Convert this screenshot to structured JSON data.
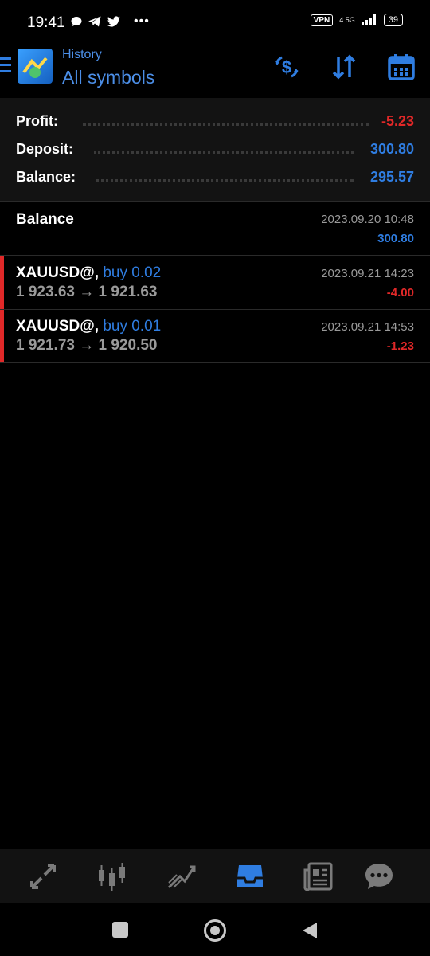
{
  "status_bar": {
    "time": "19:41",
    "vpn": "VPN",
    "network": "4.5G",
    "battery": "39"
  },
  "header": {
    "subtitle": "History",
    "title": "All symbols",
    "actions": [
      "dollar-exchange-icon",
      "sort-icon",
      "calendar-icon"
    ]
  },
  "summary": {
    "profit_label": "Profit:",
    "profit_value": "-5.23",
    "deposit_label": "Deposit:",
    "deposit_value": "300.80",
    "balance_label": "Balance:",
    "balance_value": "295.57"
  },
  "entries": [
    {
      "title": "Balance",
      "time": "2023.09.20 10:48",
      "value": "300.80"
    },
    {
      "symbol": "XAUUSD@,",
      "type": "buy 0.02",
      "prices": "1 923.63 → 1 921.63",
      "time": "2023.09.21 14:23",
      "value": "-4.00"
    },
    {
      "symbol": "XAUUSD@,",
      "type": "buy 0.01",
      "prices": "1 921.73 → 1 920.50",
      "time": "2023.09.21 14:53",
      "value": "-1.23"
    }
  ],
  "bottom_nav": [
    "quotes-icon",
    "chart-icon",
    "trade-icon",
    "history-icon",
    "news-icon",
    "chat-icon"
  ],
  "colors": {
    "accent": "#2f7de1",
    "loss": "#e02828",
    "background": "#000000"
  }
}
